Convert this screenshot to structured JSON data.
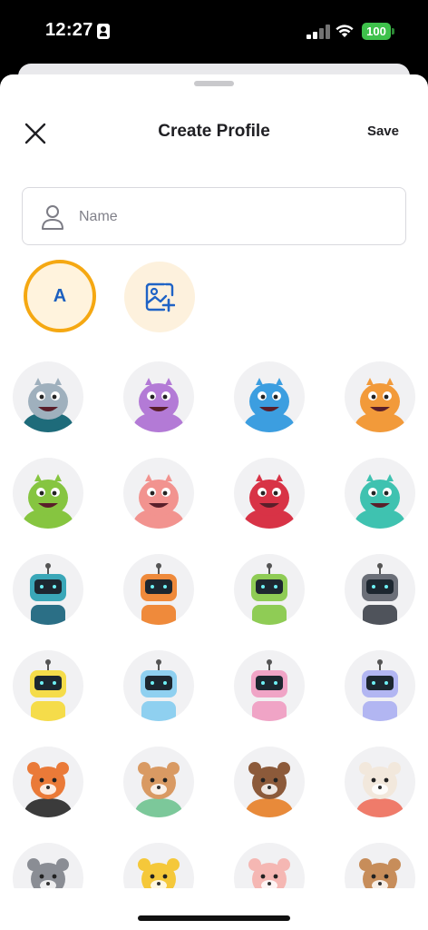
{
  "status_bar": {
    "time": "12:27",
    "battery": "100"
  },
  "header": {
    "title": "Create Profile",
    "save_label": "Save"
  },
  "name_field": {
    "placeholder": "Name",
    "value": ""
  },
  "letter_avatar": {
    "letter": "A"
  },
  "colors": {
    "accent_ring": "#f5a812",
    "letter": "#1c5fbf",
    "battery": "#3ec14b"
  },
  "avatars": [
    {
      "name": "monster-grey",
      "icon": "grey-monster-avatar",
      "body": "#9fb0bd",
      "shirt": "#1e6b7a"
    },
    {
      "name": "monster-purple",
      "icon": "purple-monster-avatar",
      "body": "#b37ad6",
      "shirt": "#b37ad6"
    },
    {
      "name": "monster-blue",
      "icon": "blue-monster-avatar",
      "body": "#3c9ee0",
      "shirt": "#3c9ee0"
    },
    {
      "name": "monster-orange",
      "icon": "orange-monster-avatar",
      "body": "#f29a3a",
      "shirt": "#f29a3a"
    },
    {
      "name": "monster-green",
      "icon": "green-monster-avatar",
      "body": "#86c540",
      "shirt": "#86c540"
    },
    {
      "name": "monster-pink",
      "icon": "pink-monster-avatar",
      "body": "#f2938f",
      "shirt": "#f2938f"
    },
    {
      "name": "monster-red",
      "icon": "red-monster-avatar",
      "body": "#d83346",
      "shirt": "#d83346"
    },
    {
      "name": "monster-teal",
      "icon": "teal-monster-avatar",
      "body": "#3fc2b0",
      "shirt": "#3fc2b0"
    },
    {
      "name": "robot-teal",
      "icon": "teal-robot-avatar",
      "body": "#3aa7b8",
      "shirt": "#2b6f86"
    },
    {
      "name": "robot-orange",
      "icon": "orange-robot-avatar",
      "body": "#ef8a3b",
      "shirt": "#ef8a3b"
    },
    {
      "name": "robot-green",
      "icon": "green-robot-avatar",
      "body": "#8fcc55",
      "shirt": "#8fcc55"
    },
    {
      "name": "robot-grey",
      "icon": "grey-robot-avatar",
      "body": "#6b6f78",
      "shirt": "#4f535b"
    },
    {
      "name": "robot-yellow",
      "icon": "yellow-robot-avatar",
      "body": "#f5dc4a",
      "shirt": "#f5dc4a"
    },
    {
      "name": "robot-lightblue",
      "icon": "light-blue-robot-avatar",
      "body": "#8fd0f0",
      "shirt": "#8fd0f0"
    },
    {
      "name": "robot-pink",
      "icon": "pink-robot-avatar",
      "body": "#f0a4c6",
      "shirt": "#f0a4c6"
    },
    {
      "name": "robot-lavender",
      "icon": "lavender-robot-avatar",
      "body": "#b2b6f2",
      "shirt": "#b2b6f2"
    },
    {
      "name": "animal-squirrel",
      "icon": "squirrel-avatar",
      "body": "#ea7a38",
      "shirt": "#3b3b3b"
    },
    {
      "name": "animal-cat",
      "icon": "cat-avatar",
      "body": "#d99a63",
      "shirt": "#7cc89a"
    },
    {
      "name": "animal-dog",
      "icon": "dog-avatar",
      "body": "#8c5a3a",
      "shirt": "#e88a3a"
    },
    {
      "name": "animal-sheep",
      "icon": "sheep-avatar",
      "body": "#f2e8dc",
      "shirt": "#ef7b6a"
    },
    {
      "name": "animal-raccoon",
      "icon": "raccoon-avatar",
      "body": "#8a8d94",
      "shirt": "#4a4d55"
    },
    {
      "name": "animal-duck",
      "icon": "duck-avatar",
      "body": "#f5c83a",
      "shirt": "#f5c83a"
    },
    {
      "name": "animal-pig",
      "icon": "pig-avatar",
      "body": "#f5b7b3",
      "shirt": "#e2603f"
    },
    {
      "name": "animal-bear",
      "icon": "bear-avatar",
      "body": "#c78d5a",
      "shirt": "#3b3b3b"
    }
  ]
}
